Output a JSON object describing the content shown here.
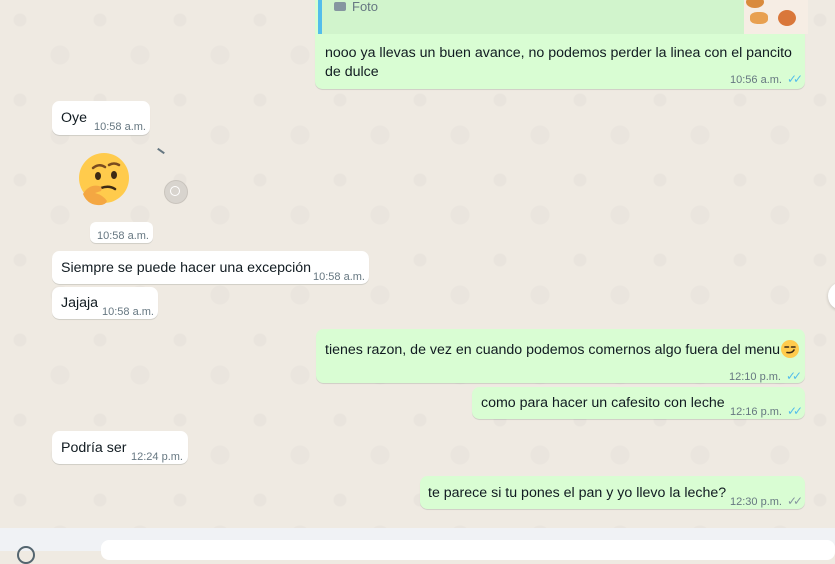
{
  "quoted_reply": {
    "icon": "camera-icon",
    "label": "Foto"
  },
  "messages": [
    {
      "direction": "out",
      "text": "nooo ya llevas un buen avance, no podemos perder la linea con el pancito de dulce",
      "time": "10:56 a.m.",
      "status": "read"
    },
    {
      "direction": "in",
      "text": "Oye",
      "time": "10:58 a.m."
    },
    {
      "direction": "in",
      "kind": "emoji",
      "emoji": "thinking-face",
      "time": "10:58 a.m."
    },
    {
      "direction": "in",
      "text": "Siempre se puede hacer una excepción",
      "time": "10:58 a.m."
    },
    {
      "direction": "in",
      "text": "Jajaja",
      "time": "10:58 a.m."
    },
    {
      "direction": "out",
      "text": "tienes razon, de vez en cuando podemos comernos algo fuera del menu",
      "emoji": "smirking-face",
      "time": "12:10 p.m.",
      "status": "read"
    },
    {
      "direction": "out",
      "text": "como para hacer un cafesito con leche",
      "time": "12:16 p.m.",
      "status": "read"
    },
    {
      "direction": "in",
      "text": "Podría ser",
      "time": "12:24 p.m."
    },
    {
      "direction": "out",
      "text": "te parece si tu pones el pan y yo llevo la leche?",
      "time": "12:30 p.m.",
      "status": "delivered"
    }
  ],
  "colors": {
    "chat_background": "#efeae2",
    "incoming_bubble": "#ffffff",
    "outgoing_bubble": "#d9fdd3",
    "read_ticks": "#53bdeb",
    "delivered_ticks": "#8696a0"
  }
}
